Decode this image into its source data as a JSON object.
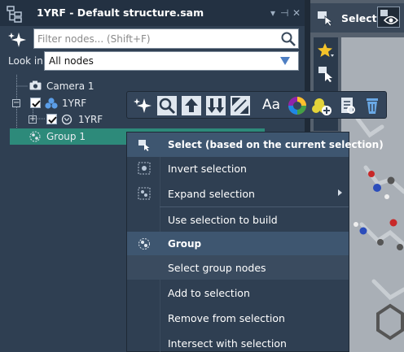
{
  "panel": {
    "title": "1YRF - Default structure.sam",
    "filter": {
      "placeholder": "Filter nodes... (Shift+F)",
      "value": ""
    },
    "look_in": {
      "label": "Look in",
      "value": "All nodes"
    }
  },
  "tree": [
    {
      "label": "Camera 1",
      "icon": "camera-icon"
    },
    {
      "label": "1YRF",
      "icon": "molecule-icon",
      "checked": true,
      "expanded": true
    },
    {
      "label": "1YRF",
      "icon": "chain-icon",
      "checked": true,
      "expanded": false
    },
    {
      "label": "Group 1",
      "icon": "group-icon",
      "selected": true
    }
  ],
  "right": {
    "select_label": "Select"
  },
  "toolbar": {
    "text_button": "Aa",
    "buttons": [
      "sparkle-icon",
      "zoom-icon",
      "arrow-up-icon",
      "arrows-updown-icon",
      "fit-icon",
      "text-icon",
      "color-wheel-icon",
      "add-to-selection-icon",
      "inspect-icon",
      "delete-icon"
    ]
  },
  "menu": {
    "header1": "Select (based on the current selection)",
    "items1": [
      {
        "label": "Invert selection",
        "icon": "invert-icon"
      },
      {
        "label": "Expand selection",
        "icon": "expand-icon",
        "submenu": true
      },
      {
        "label": "Use selection to build",
        "icon": ""
      }
    ],
    "header2": "Group",
    "items2": [
      {
        "label": "Select group nodes",
        "hover": true
      },
      {
        "label": "Add to selection"
      },
      {
        "label": "Remove from selection"
      },
      {
        "label": "Intersect with selection"
      }
    ]
  },
  "colors": {
    "panel_bg": "#2f3f52",
    "header_bg": "#233142",
    "selection": "#2d8a7a",
    "menu_header": "#3e5670"
  }
}
